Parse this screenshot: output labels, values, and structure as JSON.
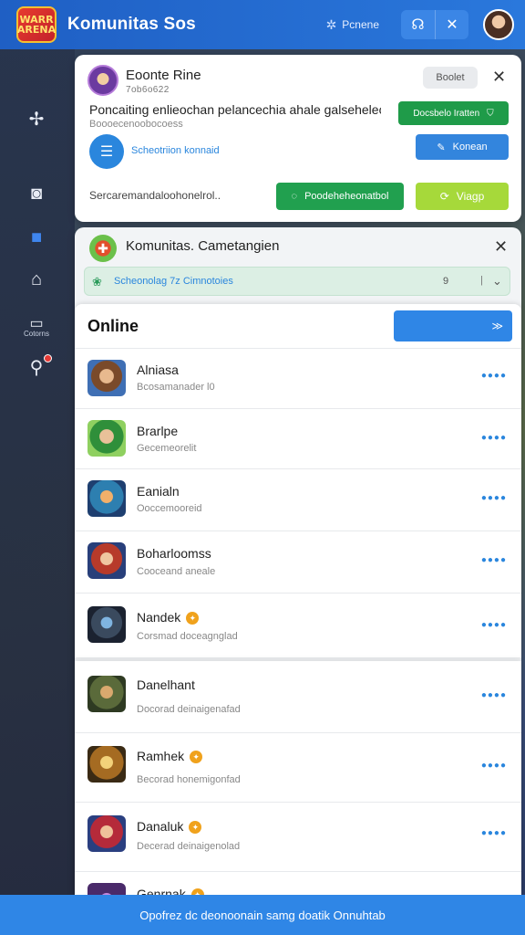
{
  "header": {
    "logo_text": "WARR\nARENA",
    "title": "Komunitas Sos",
    "status_label": "Pcnene",
    "status_icon": "gear-cluster-icon",
    "btn_headset_icon": "headset-icon",
    "btn_close_icon": "close-icon"
  },
  "rail": {
    "items": [
      {
        "icon": "navigate-icon",
        "glyph": "✢"
      },
      {
        "icon": "chat-icon",
        "glyph": "◙"
      },
      {
        "icon": "square-icon",
        "glyph": "■"
      },
      {
        "icon": "building-icon",
        "glyph": "⌂"
      },
      {
        "icon": "tv-icon",
        "glyph": "▭",
        "label": "Cotorns"
      },
      {
        "icon": "wrench-icon",
        "glyph": "⚲"
      }
    ]
  },
  "card1": {
    "name": "Eoonte Rine",
    "subline": "7ob6o622",
    "pill": "Boolet",
    "description": "Poncaiting enlieochan pelancechia ahale galsehelec..",
    "description_sub": "Boooecenoobocoess",
    "btn_green_sm": "Docsbelo Iratten",
    "link": "Scheotriion konnaid",
    "btn_blue_sm": "Konean",
    "footer_text": "Sercaremandaloohonelrol..",
    "btn_green_lg": "Poodeheheonatbol",
    "btn_lime": "Viagp"
  },
  "card2": {
    "title": "Komunitas. Cametangien",
    "banner_text": "Scheonolag 7z Cimnotoies",
    "banner_count": "9"
  },
  "online": {
    "title": "Online",
    "button_label": "≫",
    "rows": [
      {
        "name": "Alniasa",
        "status": "Bcosamanader l0",
        "more": "●●●●",
        "gold": false
      },
      {
        "name": "Brarlpe",
        "status": "Gecemeorelit",
        "more": "●●●●",
        "gold": false
      },
      {
        "name": "Eanialn",
        "status": "Ooccemooreid",
        "more": "●●●●",
        "gold": false
      },
      {
        "name": "Boharloomss",
        "status": "Cooceand aneale",
        "more": "●●●●",
        "gold": false
      },
      {
        "name": "Nandek",
        "status": "Corsmad doceagnglad",
        "more": "●●●●",
        "gold": true
      }
    ]
  },
  "list2": {
    "rows": [
      {
        "name": "Danelhant",
        "status": "Docorad deinaigenafad",
        "more": "●●●●",
        "gold": false
      },
      {
        "name": "Ramhek",
        "status": "Becorad honemigonfad",
        "more": "●●●●",
        "gold": true
      },
      {
        "name": "Danaluk",
        "status": "Decerad deinaigenolad",
        "more": "●●●●",
        "gold": true
      },
      {
        "name": "Genrnak",
        "status": "",
        "more": "",
        "gold": true
      }
    ]
  },
  "bottom_bar": {
    "text": "Opofrez dc deonoonain samg doatik Onnuhtab"
  },
  "colors": {
    "primary_blue": "#2f86e6",
    "green": "#21a04f",
    "lime": "#a6d93a"
  }
}
